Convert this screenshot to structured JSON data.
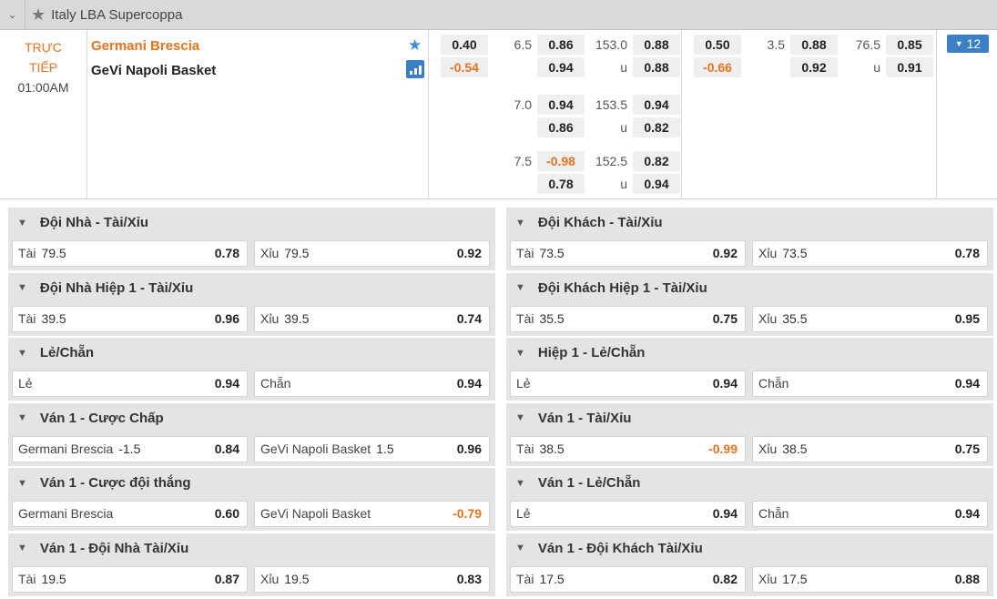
{
  "league": {
    "name": "Italy LBA Supercoppa"
  },
  "match": {
    "status": "TRỰC TIẾP",
    "time": "01:00AM",
    "home": "Germani Brescia",
    "away": "GeVi Napoli Basket",
    "more_count": "12",
    "ft_ml": [
      "0.40",
      "-0.54"
    ],
    "ft_lines": [
      {
        "hdp": "6.5",
        "hdp_home": "0.86",
        "hdp_away": "0.94",
        "ou": "153.0",
        "over": "0.88",
        "u": "u",
        "under": "0.88"
      },
      {
        "hdp": "7.0",
        "hdp_home": "0.94",
        "hdp_away": "0.86",
        "ou": "153.5",
        "over": "0.94",
        "u": "u",
        "under": "0.82"
      },
      {
        "hdp": "7.5",
        "hdp_home": "-0.98",
        "hdp_away": "0.78",
        "ou": "152.5",
        "over": "0.82",
        "u": "u",
        "under": "0.94"
      }
    ],
    "h1_ml": [
      "0.50",
      "-0.66"
    ],
    "h1_line": {
      "hdp": "3.5",
      "hdp_home": "0.88",
      "hdp_away": "0.92",
      "ou": "76.5",
      "over": "0.85",
      "u": "u",
      "under": "0.91"
    }
  },
  "markets": [
    {
      "title": "Đội Nhà - Tài/Xỉu",
      "left": {
        "name": "Tài",
        "line": "79.5",
        "price": "0.78"
      },
      "right": {
        "name": "Xỉu",
        "line": "79.5",
        "price": "0.92"
      }
    },
    {
      "title": "Đội Khách - Tài/Xỉu",
      "left": {
        "name": "Tài",
        "line": "73.5",
        "price": "0.92"
      },
      "right": {
        "name": "Xỉu",
        "line": "73.5",
        "price": "0.78"
      }
    },
    {
      "title": "Đội Nhà Hiệp 1 - Tài/Xỉu",
      "left": {
        "name": "Tài",
        "line": "39.5",
        "price": "0.96"
      },
      "right": {
        "name": "Xỉu",
        "line": "39.5",
        "price": "0.74"
      }
    },
    {
      "title": "Đội Khách Hiệp 1 - Tài/Xỉu",
      "left": {
        "name": "Tài",
        "line": "35.5",
        "price": "0.75"
      },
      "right": {
        "name": "Xỉu",
        "line": "35.5",
        "price": "0.95"
      }
    },
    {
      "title": "Lẻ/Chẵn",
      "left": {
        "name": "Lẻ",
        "line": "",
        "price": "0.94"
      },
      "right": {
        "name": "Chẵn",
        "line": "",
        "price": "0.94"
      }
    },
    {
      "title": "Hiệp 1 - Lẻ/Chẵn",
      "left": {
        "name": "Lẻ",
        "line": "",
        "price": "0.94"
      },
      "right": {
        "name": "Chẵn",
        "line": "",
        "price": "0.94"
      }
    },
    {
      "title": "Ván 1 - Cược Chấp",
      "left": {
        "name": "Germani Brescia",
        "line": "-1.5",
        "price": "0.84"
      },
      "right": {
        "name": "GeVi Napoli Basket",
        "line": "1.5",
        "price": "0.96"
      }
    },
    {
      "title": "Ván 1 - Tài/Xỉu",
      "left": {
        "name": "Tài",
        "line": "38.5",
        "price": "-0.99"
      },
      "right": {
        "name": "Xỉu",
        "line": "38.5",
        "price": "0.75"
      }
    },
    {
      "title": "Ván 1 - Cược đội thắng",
      "left": {
        "name": "Germani Brescia",
        "line": "",
        "price": "0.60"
      },
      "right": {
        "name": "GeVi Napoli Basket",
        "line": "",
        "price": "-0.79"
      }
    },
    {
      "title": "Ván 1 - Lẻ/Chẵn",
      "left": {
        "name": "Lẻ",
        "line": "",
        "price": "0.94"
      },
      "right": {
        "name": "Chẵn",
        "line": "",
        "price": "0.94"
      }
    },
    {
      "title": "Ván 1 - Đội Nhà Tài/Xỉu",
      "left": {
        "name": "Tài",
        "line": "19.5",
        "price": "0.87"
      },
      "right": {
        "name": "Xỉu",
        "line": "19.5",
        "price": "0.83"
      }
    },
    {
      "title": "Ván 1 - Đội Khách Tài/Xỉu",
      "left": {
        "name": "Tài",
        "line": "17.5",
        "price": "0.82"
      },
      "right": {
        "name": "Xỉu",
        "line": "17.5",
        "price": "0.88"
      }
    }
  ],
  "colors": {
    "accent": "#3b7fc4",
    "negative": "#e8731d",
    "header_bg": "#d9d9d9",
    "market_bg": "#e4e4e4"
  },
  "icons": {
    "collapse": "chevron-down-icon",
    "league_fav": "star-icon",
    "match_fav": "star-icon",
    "stats": "bar-chart-icon",
    "more": "triangle-down-icon"
  }
}
